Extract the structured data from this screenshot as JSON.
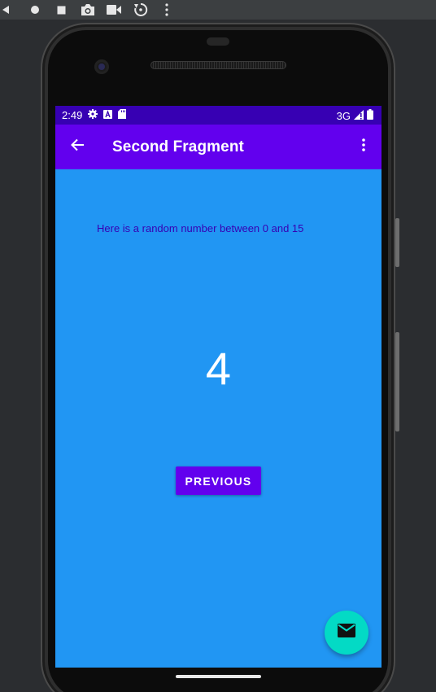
{
  "emulator_toolbar": {
    "icons": [
      "back-triangle-icon",
      "home-circle-icon",
      "overview-square-icon",
      "camera-icon",
      "video-icon",
      "rotate-icon",
      "more-vert-icon"
    ]
  },
  "status_bar": {
    "time": "2:49",
    "network": "3G",
    "icons": [
      "gear-icon",
      "a-box-icon",
      "sd-card-icon",
      "signal-icon",
      "battery-icon"
    ]
  },
  "app_bar": {
    "title": "Second Fragment",
    "nav_icon": "arrow-back-icon",
    "menu_icon": "more-vert-icon"
  },
  "content": {
    "description": "Here is a random number between 0 and 15",
    "random_number": "4",
    "previous_button": "PREVIOUS"
  },
  "fab": {
    "icon": "email-icon"
  },
  "colors": {
    "primary": "#6200ee",
    "primary_dark": "#3700b3",
    "background": "#2196f3",
    "accent": "#03dac5"
  }
}
